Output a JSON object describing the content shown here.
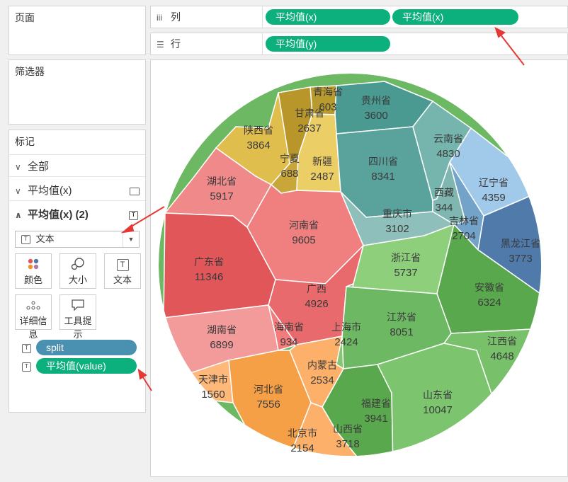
{
  "left_panel": {
    "pages_title": "页面",
    "filters_title": "筛选器",
    "marks_title": "标记",
    "mark_rows": [
      {
        "label": "全部"
      },
      {
        "label": "平均值(x)"
      },
      {
        "label": "平均值(x) (2)"
      }
    ],
    "mark_type": "文本",
    "buttons": [
      {
        "label": "颜色",
        "icon": "color-dots-icon"
      },
      {
        "label": "大小",
        "icon": "size-icon"
      },
      {
        "label": "文本",
        "icon": "text-icon"
      },
      {
        "label": "详细信息",
        "icon": "detail-icon"
      },
      {
        "label": "工具提示",
        "icon": "tooltip-icon"
      }
    ],
    "fields": [
      {
        "label": "split",
        "color": "#4a90b0"
      },
      {
        "label": "平均值(value)",
        "color": "#0cb07d"
      }
    ]
  },
  "shelves": {
    "columns": {
      "label": "列",
      "icon": "iii",
      "pills": [
        "平均值(x)",
        "平均值(x)"
      ]
    },
    "rows": {
      "label": "行",
      "icon": "☰",
      "pills": [
        "平均值(y)"
      ]
    }
  },
  "chart_data": {
    "type": "voronoi-treemap",
    "cells": [
      {
        "name": "青海省",
        "value": 603,
        "color": "#b89a2e"
      },
      {
        "name": "贵州省",
        "value": 3600,
        "color": "#4a9a92"
      },
      {
        "name": "甘肃省",
        "value": 2637,
        "color": "#b8962a"
      },
      {
        "name": "陕西省",
        "value": 3864,
        "color": "#e0be4e"
      },
      {
        "name": "宁夏",
        "value": 688,
        "color": "#c9a63a"
      },
      {
        "name": "新疆",
        "value": 2487,
        "color": "#ecce66"
      },
      {
        "name": "四川省",
        "value": 8341,
        "color": "#5aa39c"
      },
      {
        "name": "云南省",
        "value": 4830,
        "color": "#76b5ad"
      },
      {
        "name": "辽宁省",
        "value": 4359,
        "color": "#a0c9ea"
      },
      {
        "name": "西藏",
        "value": 344,
        "color": "#7fb6b0"
      },
      {
        "name": "重庆市",
        "value": 3102,
        "color": "#8ebfba"
      },
      {
        "name": "吉林省",
        "value": 2704,
        "color": "#74a3c9"
      },
      {
        "name": "黑龙江省",
        "value": 3773,
        "color": "#4f7aaa"
      },
      {
        "name": "湖北省",
        "value": 5917,
        "color": "#f08a8a"
      },
      {
        "name": "河南省",
        "value": 9605,
        "color": "#f08080"
      },
      {
        "name": "广东省",
        "value": 11346,
        "color": "#e15759"
      },
      {
        "name": "广西",
        "value": 4926,
        "color": "#e86a6c"
      },
      {
        "name": "湖南省",
        "value": 6899,
        "color": "#f39a9a"
      },
      {
        "name": "海南省",
        "value": 934,
        "color": "#f27c7c"
      },
      {
        "name": "浙江省",
        "value": 5737,
        "color": "#8dcf7a"
      },
      {
        "name": "安徽省",
        "value": 6324,
        "color": "#5aa84e"
      },
      {
        "name": "上海市",
        "value": 2424,
        "color": "#84c674"
      },
      {
        "name": "江苏省",
        "value": 8051,
        "color": "#6db862"
      },
      {
        "name": "江西省",
        "value": 4648,
        "color": "#78c06a"
      },
      {
        "name": "内蒙古",
        "value": 2534,
        "color": "#fdb06a"
      },
      {
        "name": "天津市",
        "value": 1560,
        "color": "#fdb87a"
      },
      {
        "name": "河北省",
        "value": 7556,
        "color": "#f5a046"
      },
      {
        "name": "福建省",
        "value": 3941,
        "color": "#5aa84e"
      },
      {
        "name": "山东省",
        "value": 10047,
        "color": "#7cc46e"
      },
      {
        "name": "北京市",
        "value": 2154,
        "color": "#ee8a2a"
      },
      {
        "name": "山西省",
        "value": 3718,
        "color": "#fdb06a"
      }
    ]
  }
}
